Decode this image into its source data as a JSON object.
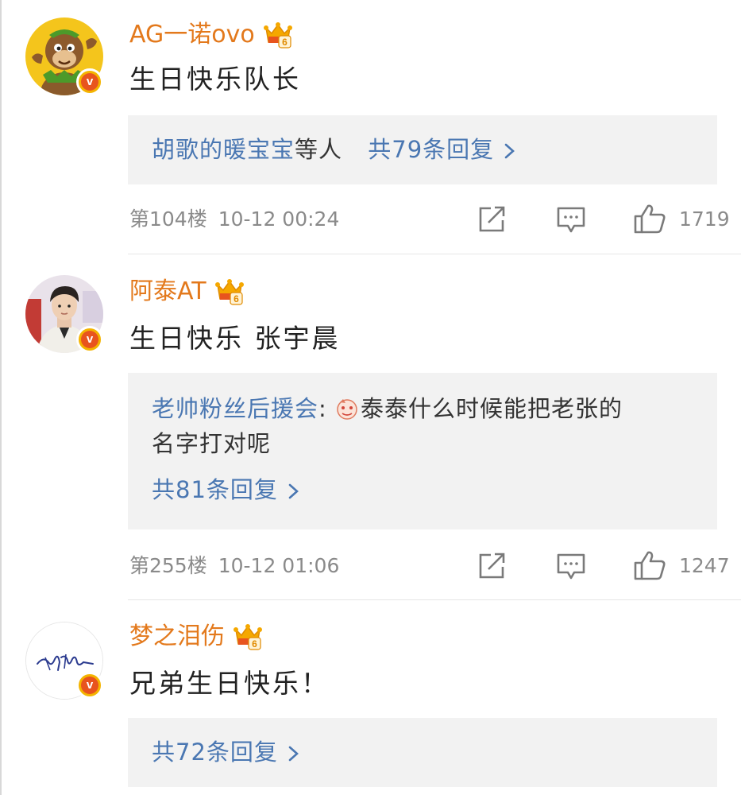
{
  "comments": [
    {
      "username": "AG一诺ovo",
      "text": "生日快乐队长",
      "reply": {
        "preview_user": "胡歌的暖宝宝",
        "suffix": "等人",
        "count_label": "共79条回复"
      },
      "floor": "第104楼",
      "timestamp": "10-12 00:24",
      "likes": "1719",
      "avatar_icon": "cartoon-monkey-avatar"
    },
    {
      "username": "阿泰AT",
      "text": "生日快乐 张宇晨",
      "reply": {
        "preview_user": "老帅粉丝后援会",
        "separator": ":",
        "preview_text_line1": "泰泰什么时候能把老张的",
        "preview_text_line2": "名字打对呢",
        "count_label": "共81条回复"
      },
      "floor": "第255楼",
      "timestamp": "10-12 01:06",
      "likes": "1247",
      "avatar_icon": "person-photo-avatar"
    },
    {
      "username": "梦之泪伤",
      "text": "兄弟生日快乐！",
      "reply": {
        "count_label": "共72条回复"
      },
      "avatar_icon": "signature-avatar"
    }
  ],
  "badge": {
    "vip_level": "6",
    "verified_letter": "v"
  },
  "colors": {
    "username": "#e3791c",
    "link": "#4a77b2",
    "meta": "#8a8a8a",
    "reply_bg": "#f2f2f2",
    "verified_bg": "#e8541e",
    "verified_ring": "#f4b400"
  }
}
